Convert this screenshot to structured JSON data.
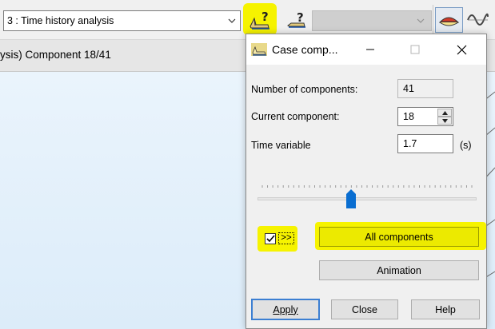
{
  "toolbar": {
    "case_select": {
      "value": "3 : Time history analysis"
    },
    "icons": {
      "case_components": "ship-question-icon",
      "help_case": "ship-question-icon-small",
      "section": "ship-section-icon",
      "wave": "wave-icon"
    }
  },
  "background_window": {
    "title": "ysis) Component 18/41"
  },
  "dialog": {
    "title": "Case comp...",
    "number_of_components": {
      "label": "Number of components:",
      "value": "41"
    },
    "current_component": {
      "label": "Current component:",
      "value": "18"
    },
    "time_variable": {
      "label": "Time variable",
      "value": "1.7",
      "unit": "(s)"
    },
    "slider": {
      "current": 18,
      "max": 41
    },
    "checkbox": {
      "checked": true,
      "label": ">>"
    },
    "buttons": {
      "all_components": "All components",
      "animation": "Animation",
      "apply": "Apply",
      "close": "Close",
      "help": "Help"
    }
  },
  "colors": {
    "highlight": "#f6f300",
    "slider_thumb": "#0a6ed1",
    "focus_border": "#3c7fd2"
  }
}
